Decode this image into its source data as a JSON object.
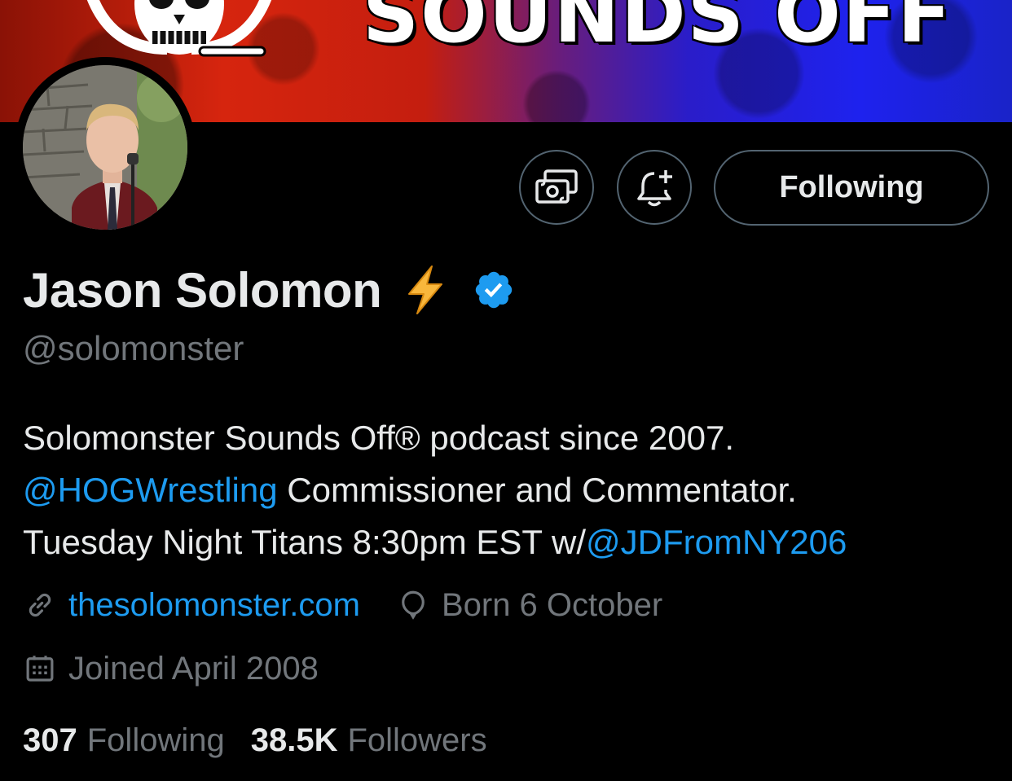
{
  "banner": {
    "title": "SOUNDS OFF"
  },
  "profile": {
    "display_name": "Jason Solomon",
    "name_emoji": "lightning-icon",
    "verified": true,
    "handle": "@solomonster",
    "bio": {
      "line1": "Solomonster Sounds Off® podcast since 2007.",
      "line2_mention": "@HOGWrestling",
      "line2_text": " Commissioner and Commentator.",
      "line3_text": "Tuesday Night Titans 8:30pm EST w/",
      "line3_mention": "@JDFromNY206"
    },
    "website": "thesolomonster.com",
    "birthday": "Born 6 October",
    "joined": "Joined April 2008"
  },
  "actions": {
    "subscribe_icon": "money-icon",
    "notify_icon": "bell-plus-icon",
    "follow_label": "Following"
  },
  "stats": {
    "following_count": "307",
    "following_label": "Following",
    "followers_count": "38.5K",
    "followers_label": "Followers"
  },
  "colors": {
    "background": "#000000",
    "text": "#e7e9ea",
    "secondary_text": "#71767b",
    "link": "#1d9bf0",
    "verified": "#1d9bf0",
    "button_border": "#536471"
  }
}
